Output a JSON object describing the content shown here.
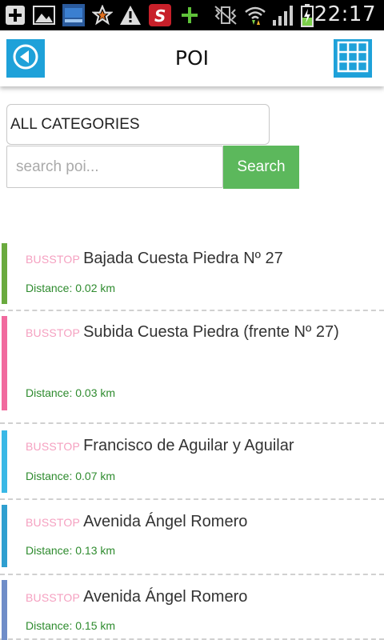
{
  "status_bar": {
    "time": "22:17",
    "icons": [
      "add-box-icon",
      "image-icon",
      "app-thumbnail-icon",
      "star-icon",
      "warning-icon",
      "s-app-icon",
      "plus-icon",
      "vibrate-mute-icon",
      "wifi-icon",
      "signal-icon",
      "battery-charging-icon"
    ]
  },
  "header": {
    "title": "POI",
    "back_icon": "back-arrow-icon",
    "menu_icon": "grid-menu-icon"
  },
  "filters": {
    "category": "ALL CATEGORIES",
    "search_placeholder": "search poi...",
    "search_value": "",
    "search_button": "Search"
  },
  "poi_items": [
    {
      "category": "BUSSTOP",
      "name": "Bajada Cuesta Piedra Nº 27",
      "distance": "Distance: 0.02 km",
      "color": "#6aaa3e"
    },
    {
      "category": "BUSSTOP",
      "name": "Subida Cuesta Piedra (frente Nº 27)",
      "distance": "Distance: 0.03 km",
      "color": "#f16a9e"
    },
    {
      "category": "BUSSTOP",
      "name": "Francisco de Aguilar y Aguilar",
      "distance": "Distance: 0.07 km",
      "color": "#39b8e6"
    },
    {
      "category": "BUSSTOP",
      "name": "Avenida Ángel Romero",
      "distance": "Distance: 0.13 km",
      "color": "#2f9fd0"
    },
    {
      "category": "BUSSTOP",
      "name": "Avenida Ángel Romero",
      "distance": "Distance: 0.15 km",
      "color": "#6f8dc8"
    }
  ],
  "colors": {
    "accent": "#1ea1d9",
    "search_button": "#5cb85c",
    "distance_text": "#2e8b2e",
    "category_text": "#f5a0c0"
  }
}
